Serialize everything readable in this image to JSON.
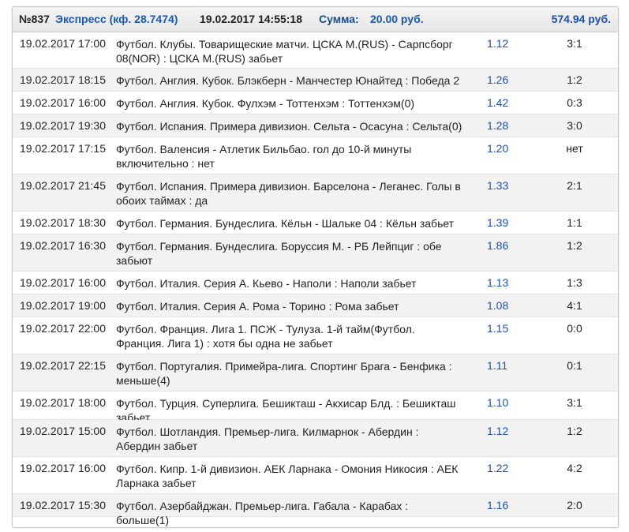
{
  "header": {
    "number": "№837",
    "type": "Экспресс (кф. 28.7474)",
    "datetime": "19.02.2017 14:55:18",
    "sum_label": "Сумма:",
    "sum_value": "20.00 руб.",
    "payout": "574.94 руб."
  },
  "rows": [
    {
      "date": "19.02.2017 17:00",
      "event": "Футбол. Клубы. Товарищеские матчи. ЦСКА М.(RUS) - Сарпсборг 08(NOR) : ЦСКА М.(RUS) забьет",
      "coef": "1.12",
      "score": "3:1"
    },
    {
      "date": "19.02.2017 18:15",
      "event": "Футбол. Англия. Кубок. Блэкберн - Манчестер Юнайтед : Победа 2",
      "coef": "1.26",
      "score": "1:2"
    },
    {
      "date": "19.02.2017 16:00",
      "event": "Футбол. Англия. Кубок. Фулхэм - Тоттенхэм : Тоттенхэм(0)",
      "coef": "1.42",
      "score": "0:3"
    },
    {
      "date": "19.02.2017 19:30",
      "event": "Футбол. Испания. Примера дивизион. Сельта - Осасуна : Сельта(0)",
      "coef": "1.28",
      "score": "3:0"
    },
    {
      "date": "19.02.2017 17:15",
      "event": "Футбол. Валенсия - Атлетик Бильбао. гол до 10-й минуты включительно : нет",
      "coef": "1.20",
      "score": "нет"
    },
    {
      "date": "19.02.2017 21:45",
      "event": "Футбол. Испания. Примера дивизион. Барселона - Леганес. Голы в обоих таймах : да",
      "coef": "1.33",
      "score": "2:1"
    },
    {
      "date": "19.02.2017 18:30",
      "event": "Футбол. Германия. Бундеслига. Кёльн - Шальке 04 : Кёльн забьет",
      "coef": "1.39",
      "score": "1:1"
    },
    {
      "date": "19.02.2017 16:30",
      "event": "Футбол. Германия. Бундеслига. Боруссия М. - РБ Лейпциг : обе забьют",
      "coef": "1.86",
      "score": "1:2"
    },
    {
      "date": "19.02.2017 16:00",
      "event": "Футбол. Италия. Серия А. Кьево - Наполи : Наполи забьет",
      "coef": "1.13",
      "score": "1:3"
    },
    {
      "date": "19.02.2017 19:00",
      "event": "Футбол. Италия. Серия А. Рома - Торино : Рома забьет",
      "coef": "1.08",
      "score": "4:1"
    },
    {
      "date": "19.02.2017 22:00",
      "event": "Футбол. Франция. Лига 1. ПСЖ - Тулуза. 1-й тайм(Футбол. Франция. Лига 1) : хотя бы одна не забьет",
      "coef": "1.15",
      "score": "0:0"
    },
    {
      "date": "19.02.2017 22:15",
      "event": "Футбол. Португалия. Примейра-лига. Спортинг Брага - Бенфика : меньше(4)",
      "coef": "1.11",
      "score": "0:1"
    },
    {
      "date": "19.02.2017 18:00",
      "event": "Футбол. Турция. Суперлига. Бешикташ - Акхисар Блд. : Бешикташ забьет",
      "coef": "1.10",
      "score": "3:1"
    },
    {
      "date": "19.02.2017 15:00",
      "event": "Футбол. Шотландия. Премьер-лига. Килмарнок - Абердин : Абердин забьет",
      "coef": "1.12",
      "score": "1:2"
    },
    {
      "date": "19.02.2017 16:00",
      "event": "Футбол. Кипр. 1-й дивизион. АЕК Ларнака - Омония Никосия : АЕК Ларнака забьет",
      "coef": "1.22",
      "score": "4:2"
    },
    {
      "date": "19.02.2017 15:30",
      "event": "Футбол. Азербайджан. Премьер-лига. Габала - Карабах : больше(1)",
      "coef": "1.16",
      "score": "2:0"
    }
  ]
}
